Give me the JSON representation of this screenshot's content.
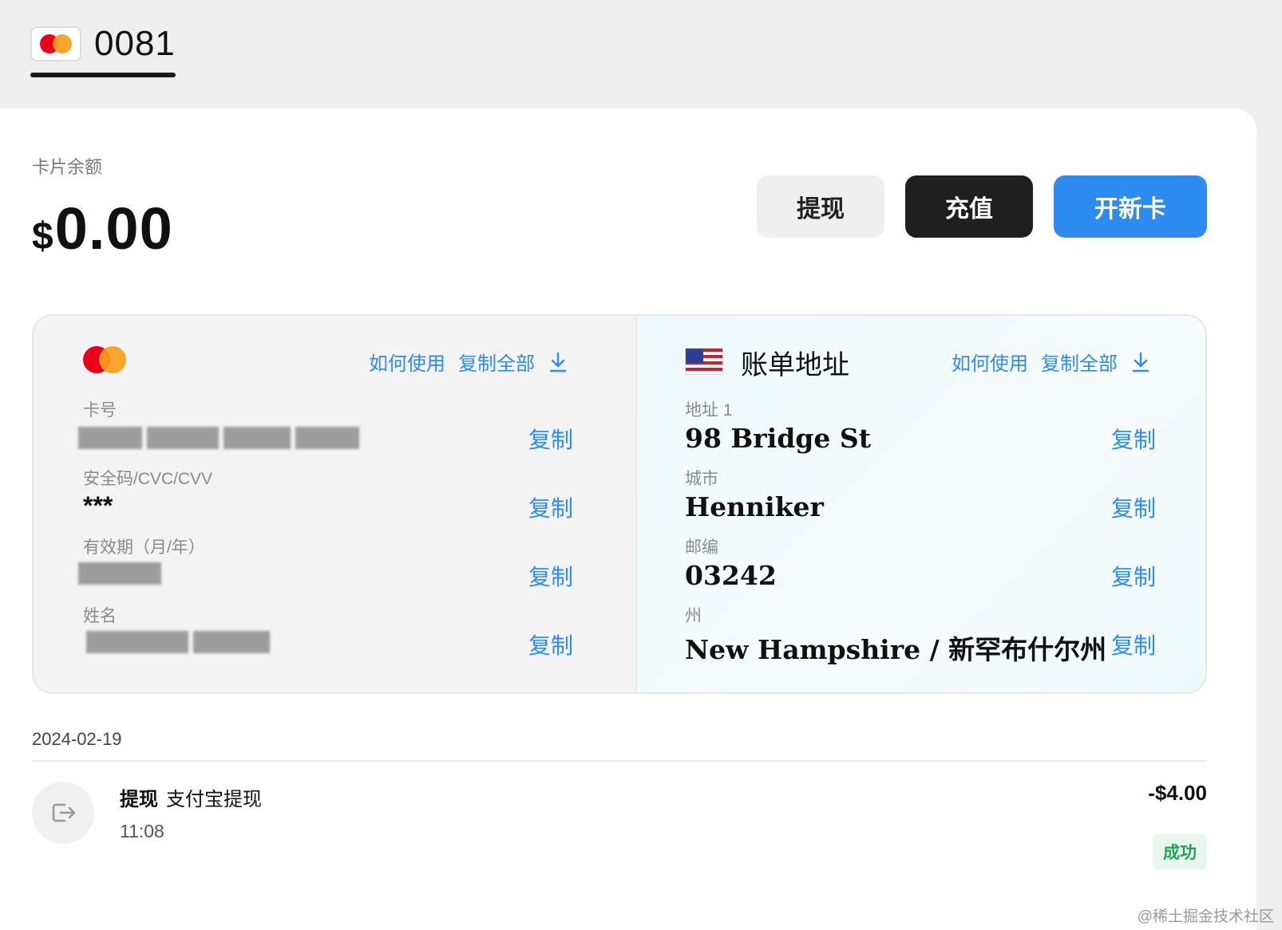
{
  "tab": {
    "label": "0081"
  },
  "balance": {
    "label": "卡片余额",
    "currency": "$",
    "amount": "0.00"
  },
  "actions": {
    "withdraw": "提现",
    "topup": "充值",
    "new_card": "开新卡"
  },
  "card_section": {
    "how_to_use": "如何使用",
    "copy_all": "复制全部",
    "fields": [
      {
        "label": "卡号",
        "value": ""
      },
      {
        "label": "安全码/CVC/CVV",
        "value": "***"
      },
      {
        "label": "有效期（月/年）",
        "value": ""
      },
      {
        "label": "姓名",
        "value": ""
      }
    ],
    "copy_label": "复制"
  },
  "billing_section": {
    "title": "账单地址",
    "how_to_use": "如何使用",
    "copy_all": "复制全部",
    "fields": [
      {
        "label": "地址 1",
        "value": "98 Bridge St"
      },
      {
        "label": "城市",
        "value": "Henniker"
      },
      {
        "label": "邮编",
        "value": "03242"
      },
      {
        "label": "州",
        "value": "New Hampshire / 新罕布什尔州"
      }
    ],
    "copy_label": "复制"
  },
  "transactions": {
    "date": "2024-02-19",
    "items": [
      {
        "type": "提现",
        "desc": "支付宝提现",
        "time": "11:08",
        "amount": "-$4.00",
        "status": "成功"
      }
    ]
  },
  "watermark": "@稀土掘金技术社区",
  "colors": {
    "accent": "#2e8bf0",
    "dark_button": "#1f1f1f",
    "success": "#23a35a"
  }
}
